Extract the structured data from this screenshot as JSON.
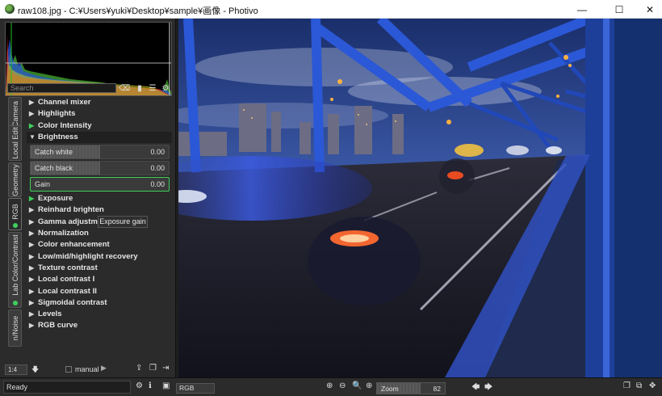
{
  "window": {
    "title": "raw108.jpg - C:¥Users¥yuki¥Desktop¥sample¥画像 - Photivo",
    "minimize_glyph": "—",
    "maximize_glyph": "☐",
    "close_glyph": "✕"
  },
  "search": {
    "placeholder": "Search",
    "value": ""
  },
  "tabs": [
    {
      "label": "Camera",
      "active": false
    },
    {
      "label": "Local Edit",
      "active": false
    },
    {
      "label": "Geometry",
      "active": false
    },
    {
      "label": "RGB",
      "active": true
    },
    {
      "label": "Lab Color/Contrast",
      "active": false
    },
    {
      "label": "n/Noise",
      "active": false
    }
  ],
  "tools": {
    "channel_mixer": "Channel mixer",
    "highlights": "Highlights",
    "color_intensity": "Color Intensity",
    "brightness": "Brightness",
    "catch_white": {
      "label": "Catch white",
      "value": "0.00"
    },
    "catch_black": {
      "label": "Catch black",
      "value": "0.00"
    },
    "gain": {
      "label": "Gain",
      "value": "0.00"
    },
    "exposure": "Exposure",
    "reinhard_brighten": "Reinhard brighten",
    "gamma_adjustment": "Gamma adjustment",
    "normalization": "Normalization",
    "color_enhancement": "Color enhancement",
    "low_mid_highlight_recovery": "Low/mid/highlight recovery",
    "texture_contrast": "Texture contrast",
    "local_contrast_1": "Local contrast I",
    "local_contrast_2": "Local contrast II",
    "sigmoidal_contrast": "Sigmoidal contrast",
    "levels": "Levels",
    "rgb_curve": "RGB curve"
  },
  "tooltip": "Exposure gain",
  "bottom_controls": {
    "scale_value": "1:4",
    "manual_label": "manual",
    "manual_checked": false
  },
  "status": {
    "text": "Ready"
  },
  "view": {
    "channel_select": "RGB",
    "zoom_label": "Zoom",
    "zoom_value": "82"
  },
  "colors": {
    "accent_green": "#3fcf5a",
    "panel_bg": "#2b2b2b",
    "sky_top": "#1b2f6e",
    "bridge_blue": "#2a55c8"
  }
}
